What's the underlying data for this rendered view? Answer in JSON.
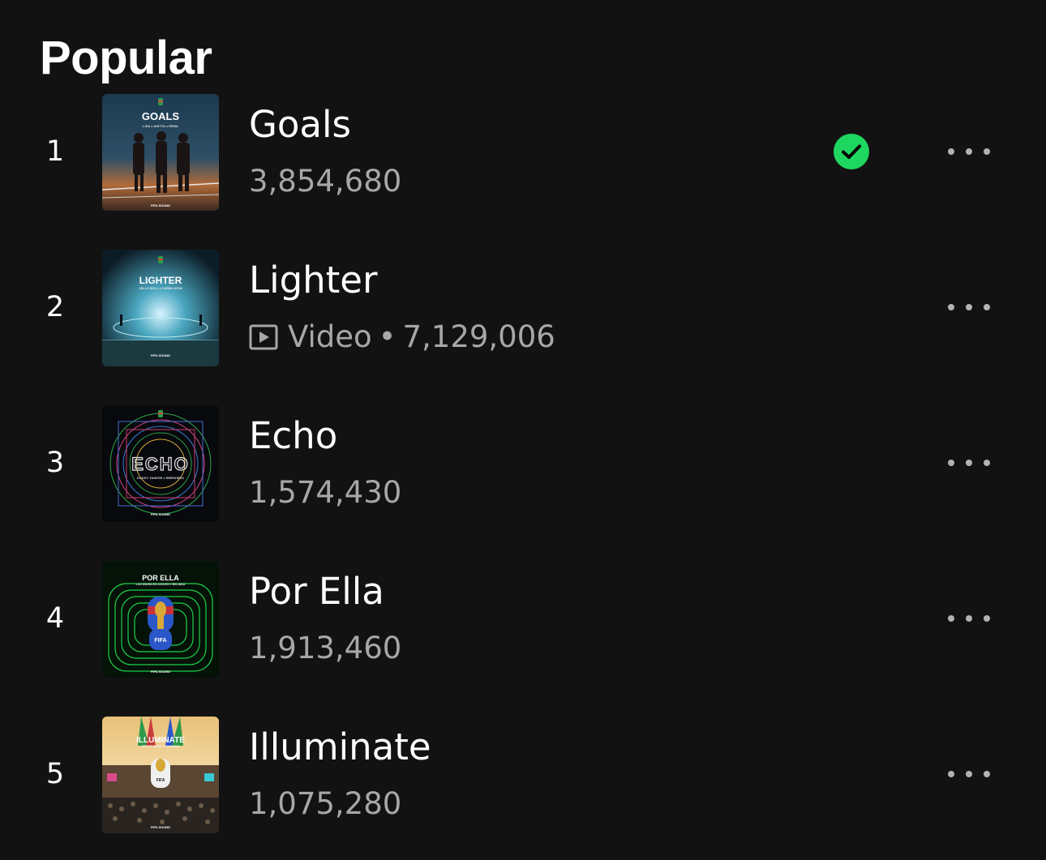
{
  "section": {
    "heading": "Popular"
  },
  "colors": {
    "background": "#121212",
    "accent": "#1ed760",
    "secondary_text": "#a7a7a7"
  },
  "tracks": [
    {
      "rank": "1",
      "title": "Goals",
      "plays": "3,854,680",
      "saved": true,
      "video": false,
      "cover": {
        "title": "GOALS",
        "artists": "LISA x ANITTA x REMA",
        "brand": "FIFA SOUND"
      }
    },
    {
      "rank": "2",
      "title": "Lighter",
      "plays": "7,129,006",
      "saved": false,
      "video": true,
      "video_label": "Video",
      "cover": {
        "title": "LIGHTER",
        "artists": "JELLY ROLL x CARÍN LEÓN",
        "brand": "FIFA SOUND"
      }
    },
    {
      "rank": "3",
      "title": "Echo",
      "plays": "1,574,430",
      "saved": false,
      "video": false,
      "cover": {
        "title": "ECHO",
        "artists": "DADDY YANKEE x BRESHEEA",
        "brand": "FIFA SOUND"
      }
    },
    {
      "rank": "4",
      "title": "Por Ella",
      "plays": "1,913,460",
      "saved": false,
      "video": false,
      "cover": {
        "title": "POR ELLA",
        "artists": "LOS ÁNGELES AZULES x BELINDA",
        "badge": "FIFA",
        "brand": "FIFA SOUND"
      }
    },
    {
      "rank": "5",
      "title": "Illuminate",
      "plays": "1,075,280",
      "saved": false,
      "video": false,
      "cover": {
        "title": "ILLUMINATE",
        "artists": "JESSIE REYEZ x ALVANNA",
        "badge": "FIFA",
        "brand": "FIFA SOUND"
      }
    }
  ],
  "icons": {
    "saved": "check-circle-icon",
    "more": "more-options-icon",
    "video": "video-play-icon"
  }
}
